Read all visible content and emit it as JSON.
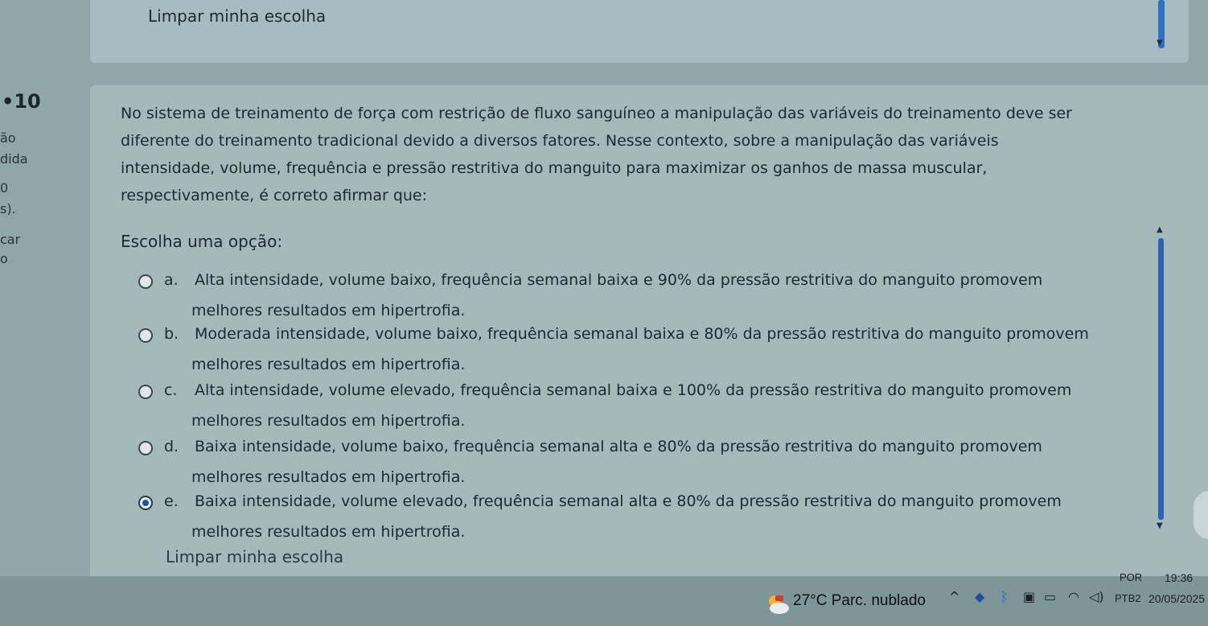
{
  "top": {
    "clear_label": "Limpar minha escolha"
  },
  "question_info": {
    "number": "10",
    "lines": [
      "ão",
      "dida",
      "0",
      "s).",
      "car",
      "o"
    ]
  },
  "question": {
    "text": "No sistema de treinamento de força com restrição de fluxo sanguíneo a manipulação das variáveis do treinamento deve ser diferente do treinamento tradicional devido a diversos fatores. Nesse contexto, sobre a manipulação das variáveis intensidade, volume, frequência e pressão restritiva do manguito para maximizar os ganhos de massa muscular, respectivamente, é correto afirmar que:",
    "lines": [
      "No sistema de treinamento de força com restrição de fluxo sanguíneo a manipulação das variáveis do treinamento deve ser",
      "diferente do treinamento tradicional devido a diversos fatores. Nesse contexto, sobre a manipulação das variáveis",
      "intensidade, volume, frequência e pressão restritiva do manguito para maximizar os ganhos de massa muscular,",
      "respectivamente, é correto afirmar que:"
    ],
    "choose_label": "Escolha uma opção:",
    "options": [
      {
        "letter": "a.",
        "line1": "Alta intensidade, volume baixo, frequência semanal baixa e 90% da pressão restritiva do manguito promovem",
        "line2": "melhores resultados em hipertrofia.",
        "selected": false
      },
      {
        "letter": "b.",
        "line1": "Moderada intensidade, volume baixo, frequência semanal baixa e 80% da pressão restritiva do manguito promovem",
        "line2": "melhores resultados em hipertrofia.",
        "selected": false
      },
      {
        "letter": "c.",
        "line1": "Alta intensidade, volume elevado, frequência semanal baixa e 100% da pressão restritiva do manguito promovem",
        "line2": "melhores resultados em hipertrofia.",
        "selected": false
      },
      {
        "letter": "d.",
        "line1": "Baixa intensidade, volume baixo, frequência semanal alta e 80% da pressão restritiva do manguito promovem",
        "line2": "melhores resultados em hipertrofia.",
        "selected": false
      },
      {
        "letter": "e.",
        "line1": "Baixa intensidade, volume elevado, frequência semanal alta e 80% da pressão restritiva do manguito promovem",
        "line2": "melhores resultados em hipertrofia.",
        "selected": true
      }
    ],
    "clear_label": "Limpar minha escolha"
  },
  "taskbar": {
    "weather": "27°C  Parc. nublado",
    "lang_top": "POR",
    "lang_bottom": "PTB2",
    "time": "19:36",
    "date": "20/05/2025"
  },
  "colors": {
    "selected_radio": "#1f4f99",
    "scrollbar": "#2a64b5"
  }
}
